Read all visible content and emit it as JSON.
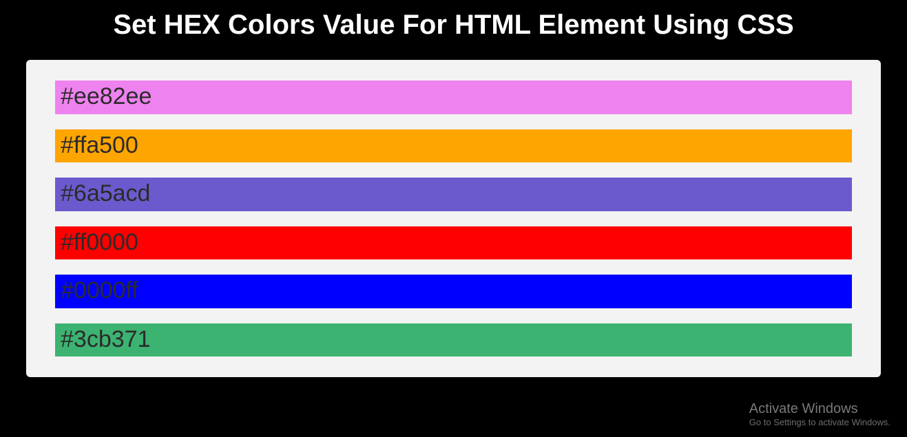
{
  "header": {
    "title": "Set HEX Colors Value For HTML Element Using CSS"
  },
  "colors": [
    {
      "label": "#ee82ee",
      "hex": "#ee82ee"
    },
    {
      "label": "#ffa500",
      "hex": "#ffa500"
    },
    {
      "label": "#6a5acd",
      "hex": "#6a5acd"
    },
    {
      "label": "#ff0000",
      "hex": "#ff0000"
    },
    {
      "label": "#0000ff",
      "hex": "#0000ff"
    },
    {
      "label": "#3cb371",
      "hex": "#3cb371"
    }
  ],
  "watermark": {
    "title": "Activate Windows",
    "sub": "Go to Settings to activate Windows."
  }
}
